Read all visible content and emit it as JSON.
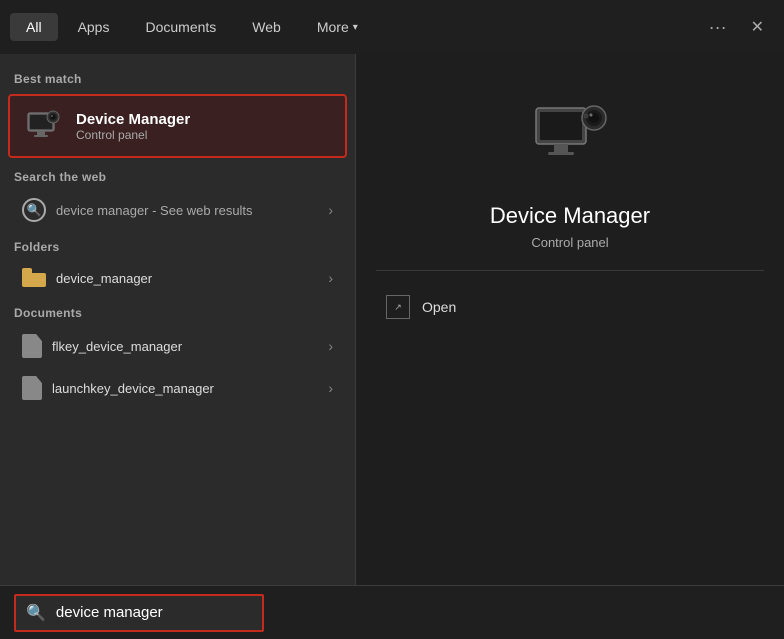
{
  "nav": {
    "tabs": [
      {
        "id": "all",
        "label": "All",
        "active": true
      },
      {
        "id": "apps",
        "label": "Apps",
        "active": false
      },
      {
        "id": "documents",
        "label": "Documents",
        "active": false
      },
      {
        "id": "web",
        "label": "Web",
        "active": false
      },
      {
        "id": "more",
        "label": "More",
        "active": false
      }
    ],
    "dots_label": "···",
    "close_label": "✕"
  },
  "best_match": {
    "section_label": "Best match",
    "title": "Device Manager",
    "subtitle": "Control panel"
  },
  "web_search": {
    "section_label": "Search the web",
    "query": "device manager",
    "suffix": " - See web results"
  },
  "folders": {
    "section_label": "Folders",
    "items": [
      {
        "name": "device_manager"
      }
    ]
  },
  "documents": {
    "section_label": "Documents",
    "items": [
      {
        "name": "flkey_device_manager"
      },
      {
        "name": "launchkey_device_manager"
      }
    ]
  },
  "right_panel": {
    "title": "Device Manager",
    "subtitle": "Control panel",
    "action": "Open"
  },
  "search_bar": {
    "value": "device manager",
    "placeholder": "device manager"
  }
}
